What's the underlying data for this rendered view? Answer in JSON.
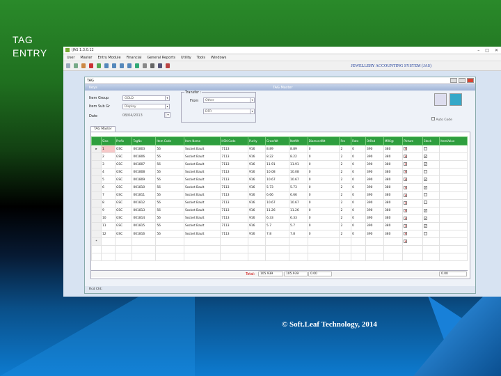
{
  "slide": {
    "title_line1": "TAG",
    "title_line2": "ENTRY",
    "footer": "© Soft.Leaf Technology, 2014"
  },
  "app": {
    "window_title": "IJAS 1.3.0.12",
    "banner": "JEWELLERY ACCOUNTING SYSTEM (JAS)"
  },
  "menu": [
    "User",
    "Master",
    "Entry Module",
    "Financial",
    "General Reports",
    "Utility",
    "Tools",
    "Windows"
  ],
  "child": {
    "title": "TAG",
    "keys": "Keys",
    "header": "TAG Master"
  },
  "form": {
    "item_group_label": "Item Group",
    "item_group_value": "GOLD",
    "item_sub_label": "Item Sub Gr",
    "item_sub_value": "Display",
    "date_label": "Date",
    "date_value": "08/04/2013",
    "transfer_label": "Transfer :",
    "from_label": "From",
    "from_value": "Other",
    "to_value": "DFR",
    "autocode_label": "Auto Code"
  },
  "tab_label": "TAG Master",
  "columns": [
    "",
    "Sino",
    "Prefix",
    "TagNo",
    "Item Code",
    "Item Name",
    "HSN Code",
    "Purity",
    "GrossWt",
    "NetWt",
    "DiamondWt",
    "Pcs",
    "Rate",
    "OtRsd",
    "MRK@",
    "Picture",
    "Stock",
    "ItemValue"
  ],
  "rows": [
    [
      "▸",
      "1",
      "GSC",
      "001803",
      "56",
      "Socket Bault",
      "7113",
      "916",
      "8.89",
      "8.89",
      "0",
      "2",
      "0",
      "390",
      "380",
      "✕",
      "",
      ""
    ],
    [
      "",
      "2",
      "GSC",
      "001806",
      "56",
      "Socket Bault",
      "7113",
      "916",
      "8.22",
      "8.22",
      "0",
      "2",
      "0",
      "390",
      "380",
      "✕",
      "✓",
      ""
    ],
    [
      "",
      "3",
      "GSC",
      "001807",
      "56",
      "Socket Bault",
      "7113",
      "916",
      "11.91",
      "11.91",
      "0",
      "2",
      "0",
      "390",
      "380",
      "✕",
      "✓",
      ""
    ],
    [
      "",
      "4",
      "GSC",
      "001808",
      "56",
      "Socket Bault",
      "7113",
      "916",
      "10.08",
      "10.08",
      "0",
      "2",
      "0",
      "390",
      "380",
      "✕",
      "",
      ""
    ],
    [
      "",
      "5",
      "GSC",
      "001809",
      "56",
      "Socket Bault",
      "7113",
      "916",
      "10.67",
      "10.67",
      "0",
      "2",
      "0",
      "390",
      "380",
      "✕",
      "✓",
      ""
    ],
    [
      "",
      "6",
      "GSC",
      "001810",
      "56",
      "Socket Bault",
      "7113",
      "916",
      "5.73",
      "5.73",
      "0",
      "2",
      "0",
      "390",
      "380",
      "✕",
      "✓",
      ""
    ],
    [
      "",
      "7",
      "GSC",
      "001811",
      "56",
      "Socket Bault",
      "7113",
      "916",
      "6.66",
      "6.66",
      "0",
      "2",
      "0",
      "390",
      "380",
      "✕",
      "",
      ""
    ],
    [
      "",
      "8",
      "GSC",
      "001812",
      "56",
      "Socket Bault",
      "7113",
      "916",
      "10.67",
      "10.67",
      "0",
      "2",
      "0",
      "390",
      "380",
      "✕",
      "",
      ""
    ],
    [
      "",
      "9",
      "GSC",
      "001813",
      "56",
      "Socket Bault",
      "7113",
      "916",
      "11.26",
      "11.26",
      "0",
      "2",
      "0",
      "390",
      "380",
      "✕",
      "✓",
      ""
    ],
    [
      "",
      "10",
      "GSC",
      "001814",
      "56",
      "Socket Bault",
      "7113",
      "916",
      "6.33",
      "6.33",
      "0",
      "2",
      "0",
      "390",
      "380",
      "✕",
      "✓",
      ""
    ],
    [
      "",
      "11",
      "GSC",
      "001815",
      "56",
      "Socket Bault",
      "7113",
      "916",
      "5.7",
      "5.7",
      "0",
      "2",
      "0",
      "390",
      "380",
      "✕",
      "✓",
      ""
    ],
    [
      "",
      "12",
      "GSC",
      "001816",
      "56",
      "Socket Bault",
      "7113",
      "916",
      "7.8",
      "7.8",
      "0",
      "2",
      "0",
      "390",
      "380",
      "✕",
      "",
      ""
    ],
    [
      "*",
      "",
      "",
      "",
      "",
      "",
      "",
      "",
      "",
      "",
      "",
      "",
      "",
      "",
      "",
      "✕",
      "",
      ""
    ]
  ],
  "totals": {
    "label": "Total:",
    "gross": "105.939",
    "net": "105.939",
    "diamond": "0.00",
    "value": "0.00"
  },
  "status": "Rcd Cht:"
}
